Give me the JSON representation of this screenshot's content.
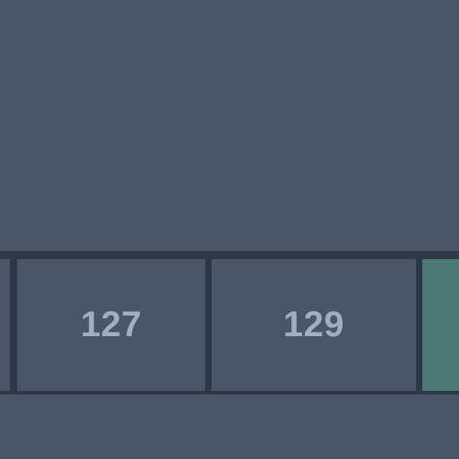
{
  "strip": {
    "cells": [
      {
        "label": ""
      },
      {
        "label": "127"
      },
      {
        "label": "129"
      },
      {
        "label": ""
      }
    ]
  },
  "colors": {
    "background": "#4a5568",
    "border": "#2d3748",
    "text": "#a0aec0",
    "highlight": "#4a7a73"
  }
}
